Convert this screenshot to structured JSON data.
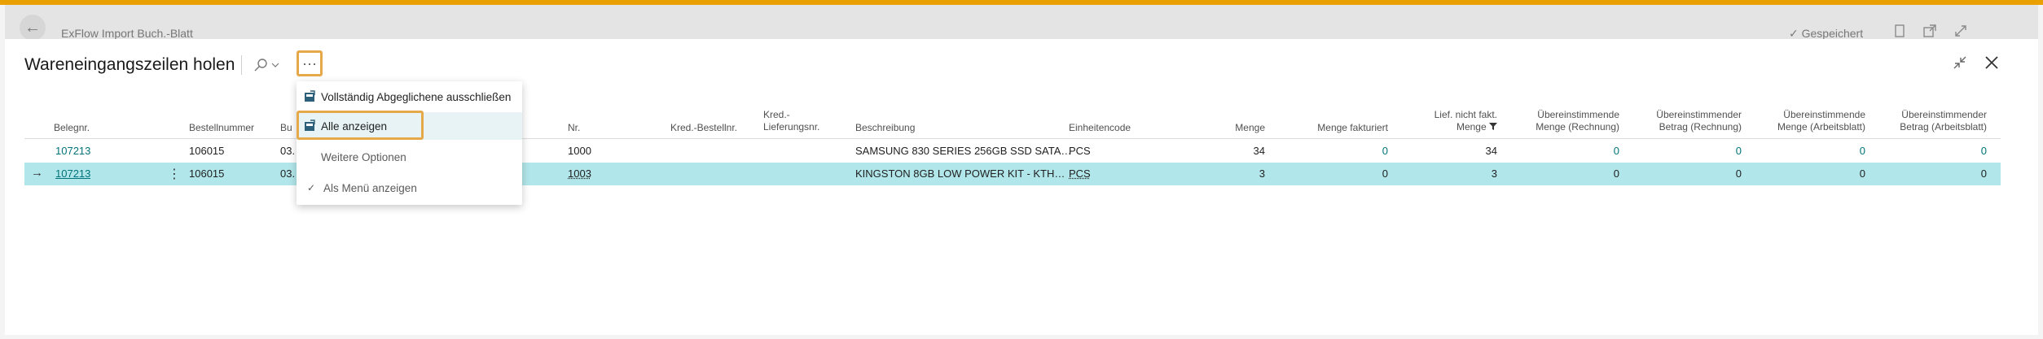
{
  "background": {
    "back_glyph": "←",
    "title": "ExFlow Import Buch.-Blatt",
    "saved": "✓ Gespeichert"
  },
  "dialog": {
    "title": "Wareneingangszeilen holen",
    "more_glyph": "···",
    "search_glyph": "⌕",
    "chev": "⌄",
    "close_glyph": "✕",
    "collapse_glyph": "⤡"
  },
  "columns": [
    {
      "l1": "",
      "l2": "Belegnr."
    },
    {
      "l1": "",
      "l2": "Bestellnummer"
    },
    {
      "l1": "",
      "l2": "Bu"
    },
    {
      "l1": "",
      "l2": "Nr."
    },
    {
      "l1": "",
      "l2": "Kred.-Bestellnr."
    },
    {
      "l1": "Kred.-",
      "l2": "Lieferungsnr."
    },
    {
      "l1": "",
      "l2": "Beschreibung"
    },
    {
      "l1": "",
      "l2": "Einheitencode"
    },
    {
      "l1": "",
      "l2": "Menge"
    },
    {
      "l1": "",
      "l2": "Menge fakturiert"
    },
    {
      "l1": "Lief. nicht fakt.",
      "l2": "Menge"
    },
    {
      "l1": "Übereinstimmende",
      "l2": "Menge (Rechnung)"
    },
    {
      "l1": "Übereinstimmender",
      "l2": "Betrag (Rechnung)"
    },
    {
      "l1": "Übereinstimmende",
      "l2": "Menge (Arbeitsblatt)"
    },
    {
      "l1": "Übereinstimmender",
      "l2": "Betrag (Arbeitsblatt)"
    }
  ],
  "rows": [
    {
      "beleg": "107213",
      "bestell": "106015",
      "bu": "03.",
      "nr": "1000",
      "beschr": "SAMSUNG 830 SERIES 256GB SSD SATA…",
      "einheit": "PCS",
      "menge": "34",
      "fakt": "0",
      "nichtfakt": "34",
      "m_r": "0",
      "b_r": "0",
      "m_a": "0",
      "b_a": "0"
    },
    {
      "beleg": "107213",
      "bestell": "106015",
      "bu": "03.",
      "nr": "1003",
      "beschr": "KINGSTON 8GB LOW POWER KIT - KTH…",
      "einheit": "PCS",
      "menge": "3",
      "fakt": "0",
      "nichtfakt": "3",
      "m_r": "0",
      "b_r": "0",
      "m_a": "0",
      "b_a": "0"
    }
  ],
  "menu": {
    "item1": "Vollständig Abgeglichene ausschließen",
    "item2": "Alle anzeigen",
    "item3": "Weitere Optionen",
    "item4": "Als Menü anzeigen",
    "check": "✓"
  },
  "colors": {
    "accent": "#00747a",
    "selected_row": "#b1e6ea",
    "highlight": "#e5a94a"
  }
}
